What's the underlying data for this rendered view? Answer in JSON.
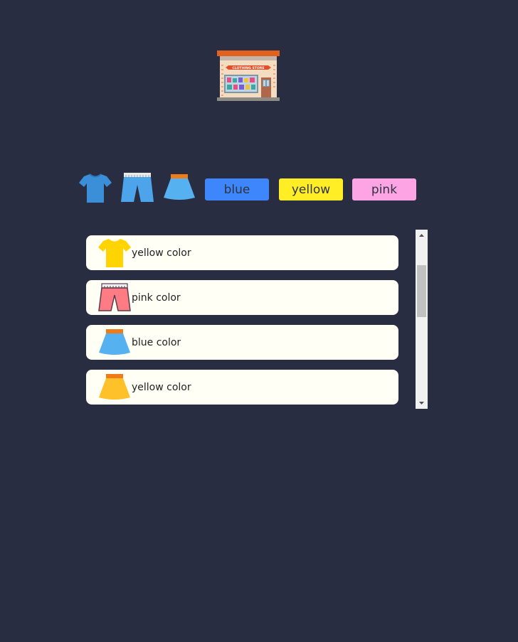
{
  "store": {
    "logo_icon": "clothing-store-icon",
    "sign_text": "CLOTHING STORE"
  },
  "filters": {
    "types": [
      {
        "name": "tshirt",
        "icon": "tshirt-icon"
      },
      {
        "name": "shorts",
        "icon": "shorts-icon"
      },
      {
        "name": "skirt",
        "icon": "skirt-icon"
      }
    ],
    "colors": [
      {
        "label": "blue",
        "bg": "#3d86fb"
      },
      {
        "label": "yellow",
        "bg": "#ffee25"
      },
      {
        "label": "pink",
        "bg": "#fda4e5"
      }
    ]
  },
  "items": [
    {
      "text": "yellow color",
      "icon": "yellow-tshirt-icon",
      "type": "tshirt",
      "color": "#ffd400"
    },
    {
      "text": "pink color",
      "icon": "pink-shorts-icon",
      "type": "shorts",
      "color": "#ff7c85"
    },
    {
      "text": "blue color",
      "icon": "blue-skirt-icon",
      "type": "skirt",
      "color": "#57b2f0"
    },
    {
      "text": "yellow color",
      "icon": "yellow-skirt-icon",
      "type": "skirt",
      "color": "#ffc12a"
    }
  ],
  "theme": {
    "background": "#282d41",
    "item_background": "#fffff5"
  }
}
